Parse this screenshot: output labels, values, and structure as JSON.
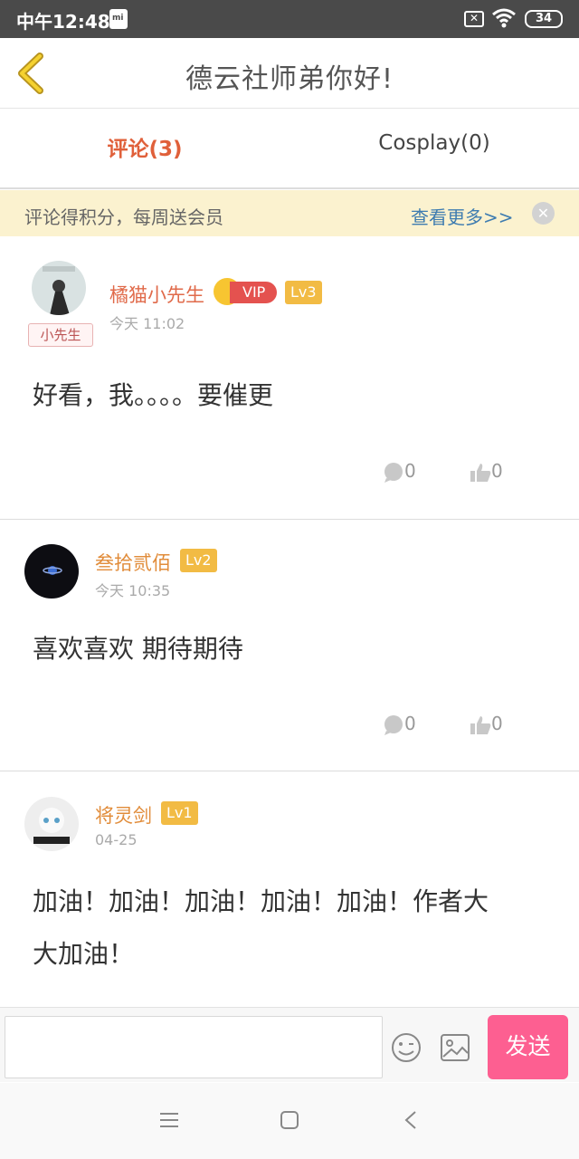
{
  "status_bar": {
    "carrier_time": "中午12:48",
    "battery": "34"
  },
  "header": {
    "title": "德云社师弟你好!"
  },
  "tabs": [
    {
      "label": "评论(3)",
      "active": true
    },
    {
      "label": "Cosplay(0)",
      "active": false
    }
  ],
  "notice": {
    "text": "评论得积分，每周送会员",
    "link": "查看更多>>"
  },
  "comments": [
    {
      "user": "橘猫小先生",
      "vip": "VIP",
      "level": "Lv3",
      "badge": "小先生",
      "time": "今天 11:02",
      "text": "好看，我。。。。要催更",
      "replies": "0",
      "likes": "0"
    },
    {
      "user": "叁拾贰佰",
      "level": "Lv2",
      "time": "今天 10:35",
      "text": "喜欢喜欢 期待期待",
      "replies": "0",
      "likes": "0"
    },
    {
      "user": "将灵剑",
      "level": "Lv1",
      "time": "04-25",
      "text_line1": "加油！加油！加油！加油！加油！作者大",
      "text_line2": "大加油！"
    }
  ],
  "input": {
    "placeholder": "",
    "send_label": "发送"
  },
  "colors": {
    "accent": "#e0603a",
    "send": "#fd5f91",
    "notice_bg": "#fbf2cf",
    "level": "#f2bb44",
    "vip": "#e4524f"
  },
  "icons": [
    "back-chevron-icon",
    "reply-bubble-icon",
    "thumbs-up-icon",
    "emoji-icon",
    "image-icon",
    "menu-icon",
    "home-icon",
    "back-nav-icon"
  ]
}
